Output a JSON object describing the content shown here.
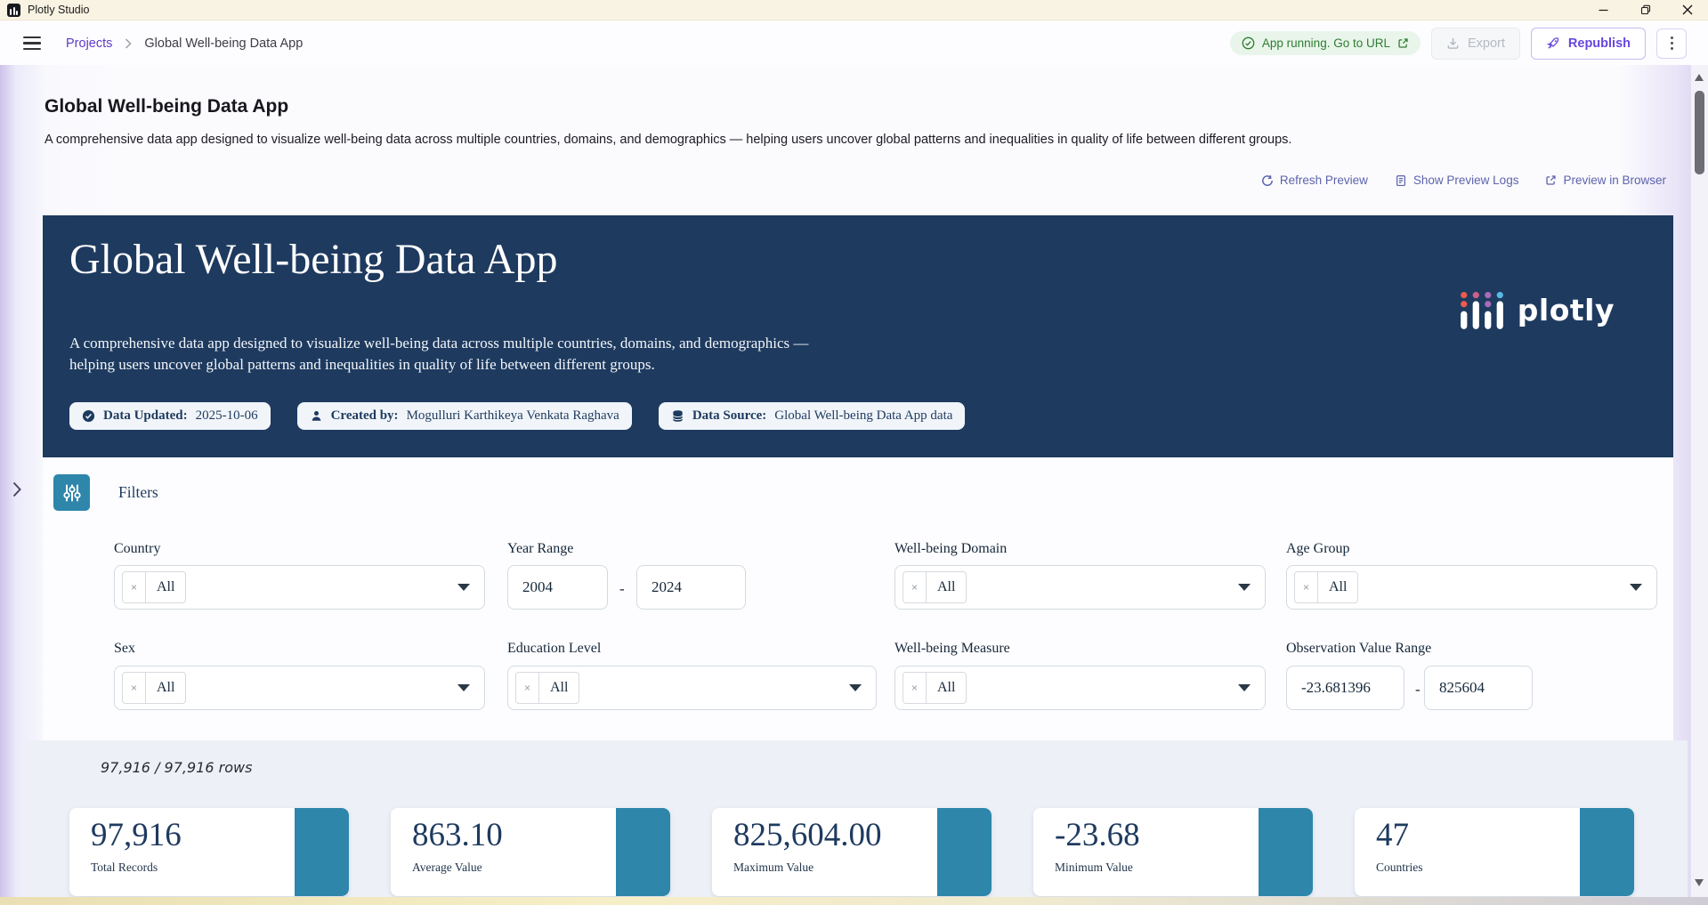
{
  "window": {
    "title": "Plotly Studio"
  },
  "toolbar": {
    "breadcrumb": {
      "projects": "Projects",
      "current": "Global Well-being Data App"
    },
    "status_badge": "App running. Go to URL",
    "export_label": "Export",
    "republish_label": "Republish"
  },
  "page_header": {
    "title": "Global Well-being Data App",
    "description": "A comprehensive data app designed to visualize well-being data across multiple countries, domains, and demographics — helping users uncover global patterns and inequalities in quality of life between different groups.",
    "actions": {
      "refresh": "Refresh Preview",
      "logs": "Show Preview Logs",
      "preview": "Preview in Browser"
    }
  },
  "hero": {
    "title": "Global Well-being Data App",
    "description": "A comprehensive data app designed to visualize well-being data across multiple countries, domains, and demographics — helping users uncover global patterns and inequalities in quality of life between different groups.",
    "badges": [
      {
        "icon": "check-circle-icon",
        "label": "Data Updated:",
        "value": "2025-10-06"
      },
      {
        "icon": "user-icon",
        "label": "Created by:",
        "value": "Mogulluri Karthikeya Venkata Raghava"
      },
      {
        "icon": "database-icon",
        "label": "Data Source:",
        "value": "Global Well-being Data App data"
      }
    ],
    "logo_text": "plotly"
  },
  "filters": {
    "title": "Filters",
    "clear_symbol": "×",
    "country": {
      "label": "Country",
      "value": "All"
    },
    "year_range": {
      "label": "Year Range",
      "from": "2004",
      "separator": "-",
      "to": "2024"
    },
    "domain": {
      "label": "Well-being Domain",
      "value": "All"
    },
    "age_group": {
      "label": "Age Group",
      "value": "All"
    },
    "sex": {
      "label": "Sex",
      "value": "All"
    },
    "education": {
      "label": "Education Level",
      "value": "All"
    },
    "measure": {
      "label": "Well-being Measure",
      "value": "All"
    },
    "value_range": {
      "label": "Observation Value Range",
      "from": "-23.681396",
      "separator": "-",
      "to": "825604"
    }
  },
  "stats": {
    "rows_summary": "97,916 / 97,916 rows",
    "cards": [
      {
        "value": "97,916",
        "label": "Total Records"
      },
      {
        "value": "863.10",
        "label": "Average Value"
      },
      {
        "value": "825,604.00",
        "label": "Maximum Value"
      },
      {
        "value": "-23.68",
        "label": "Minimum Value"
      },
      {
        "value": "47",
        "label": "Countries"
      }
    ]
  },
  "colors": {
    "hero_navy": "#1e3a5f",
    "teal_accent": "#2e86ab",
    "green_status": "#2e7d32",
    "purple_accent": "#6747e0",
    "breadcrumb_link": "#5f3dc4",
    "titlebar_cream": "#f8f3e2"
  },
  "icons": {
    "app": "plotly-bars",
    "menu": "hamburger",
    "status": "check-circle",
    "open_url": "external-link",
    "export": "download",
    "republish": "rocket",
    "more": "kebab-dots",
    "refresh": "circular-arrow",
    "logs": "document-lines",
    "preview": "external-link",
    "filters": "sliders",
    "updated": "check-circle",
    "creator": "person",
    "source": "database-cylinder"
  }
}
